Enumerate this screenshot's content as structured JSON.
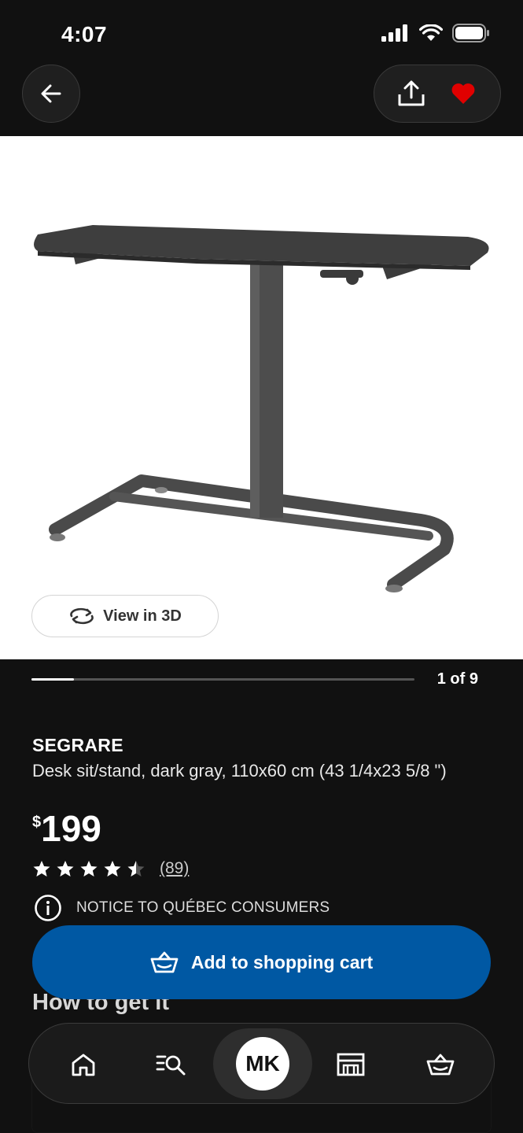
{
  "status": {
    "time": "4:07"
  },
  "nav": {
    "back_icon": "arrow-left-icon",
    "share_icon": "share-icon",
    "favorite_icon": "heart-icon",
    "favorite_color": "#e00000"
  },
  "gallery": {
    "view3d_label": "View in 3D",
    "position_label": "1 of 9",
    "progress": 0.11
  },
  "product": {
    "name": "SEGRARE",
    "description": "Desk sit/stand, dark gray, 110x60 cm (43 1/4x23 5/8 \")",
    "currency": "$",
    "price": "199",
    "rating": 4.5,
    "review_count": "(89)"
  },
  "notice": {
    "text": "NOTICE TO QUÉBEC CONSUMERS"
  },
  "cart": {
    "label": "Add to shopping cart",
    "color": "#0058a3"
  },
  "section": {
    "how_to_get": "How to get it"
  },
  "bottom_nav": {
    "avatar_initials": "MK"
  }
}
